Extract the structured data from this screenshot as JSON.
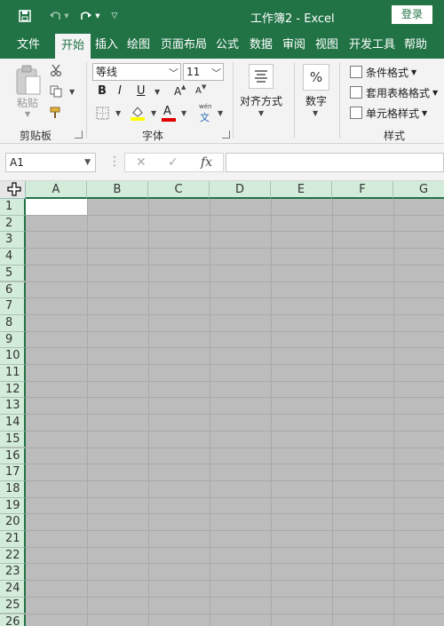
{
  "quick_access": {
    "save_icon": "save-icon",
    "undo_icon": "undo-icon",
    "redo_icon": "redo-icon",
    "customize_icon": "customize-qat-icon"
  },
  "window": {
    "title": "工作簿2  -  Excel",
    "login_label": "登录"
  },
  "tabs": [
    "文件",
    "开始",
    "插入",
    "绘图",
    "页面布局",
    "公式",
    "数据",
    "审阅",
    "视图",
    "开发工具",
    "帮助"
  ],
  "ribbon": {
    "clipboard": {
      "paste_label": "粘贴",
      "group_label": "剪贴板"
    },
    "font": {
      "font_name": "等线",
      "font_size": "11",
      "bold": "B",
      "italic": "I",
      "underline": "U",
      "grow": "A",
      "shrink": "A",
      "font_color_letter": "A",
      "phonetic_top": "wén",
      "phonetic_bottom": "文",
      "group_label": "字体"
    },
    "alignment": {
      "label": "对齐方式"
    },
    "number": {
      "symbol": "%",
      "label": "数字"
    },
    "styles": {
      "conditional": "条件格式",
      "table": "套用表格格式",
      "cell": "单元格样式",
      "group_label": "样式"
    }
  },
  "formula_bar": {
    "name_box": "A1",
    "cancel": "✕",
    "enter": "✓",
    "fx": "fx",
    "value": ""
  },
  "grid": {
    "columns": [
      "A",
      "B",
      "C",
      "D",
      "E",
      "F",
      "G"
    ],
    "rows": [
      "1",
      "2",
      "3",
      "4",
      "5",
      "6",
      "7",
      "8",
      "9",
      "10",
      "11",
      "12",
      "13",
      "14",
      "15",
      "16",
      "17",
      "18",
      "19",
      "20",
      "21",
      "22",
      "23",
      "24",
      "25",
      "26"
    ]
  },
  "colors": {
    "brand": "#217346",
    "header_highlight": "#d3ecd9",
    "sheet_dim": "#bcbcbc"
  }
}
